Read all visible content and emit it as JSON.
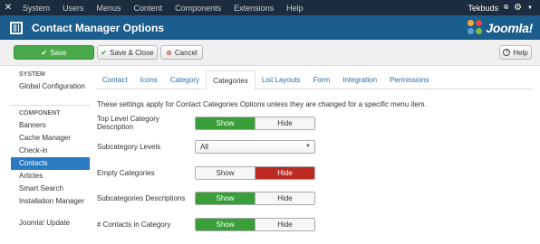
{
  "nav": {
    "menu": [
      "System",
      "Users",
      "Menus",
      "Content",
      "Components",
      "Extensions",
      "Help"
    ],
    "user": "Tekbuds",
    "logo_icon": "joomla-logo-icon",
    "gear_icon": "gear-icon"
  },
  "header": {
    "title": "Contact Manager Options",
    "brand": "Joomla!"
  },
  "toolbar": {
    "save": "Save",
    "save_close": "Save & Close",
    "cancel": "Cancel",
    "help": "Help"
  },
  "sidebar": {
    "system_heading": "SYSTEM",
    "global_config": "Global Configuration",
    "component_heading": "COMPONENT",
    "items": [
      "Banners",
      "Cache Manager",
      "Check-in",
      "Contacts",
      "Articles",
      "Smart Search",
      "Installation Manager",
      "Joomla! Update"
    ],
    "active_item": "Contacts"
  },
  "tabs": {
    "items": [
      "Contact",
      "Icons",
      "Category",
      "Categories",
      "List Layouts",
      "Form",
      "Integration",
      "Permissions"
    ],
    "active": "Categories"
  },
  "intro": "These settings apply for Contact Categories Options unless they are changed for a specific menu item.",
  "fields": {
    "top_level_desc": {
      "label": "Top Level Category Description",
      "show": "Show",
      "hide": "Hide",
      "value": "Show"
    },
    "subcategory_levels": {
      "label": "Subcategory Levels",
      "value": "All"
    },
    "empty_categories": {
      "label": "Empty Categories",
      "show": "Show",
      "hide": "Hide",
      "value": "Hide"
    },
    "subcategories_desc": {
      "label": "Subcategories Descriptions",
      "show": "Show",
      "hide": "Hide",
      "value": "Show"
    },
    "contacts_in_category": {
      "label": "# Contacts in Category",
      "show": "Show",
      "hide": "Hide",
      "value": "Show"
    }
  },
  "colors": {
    "navbar": "#1c2b3d",
    "header": "#1b5d8c",
    "save_green": "#4aa94a",
    "toggle_green": "#3a9f3a",
    "toggle_red": "#bb2b22",
    "sidebar_active": "#2a7abf"
  }
}
